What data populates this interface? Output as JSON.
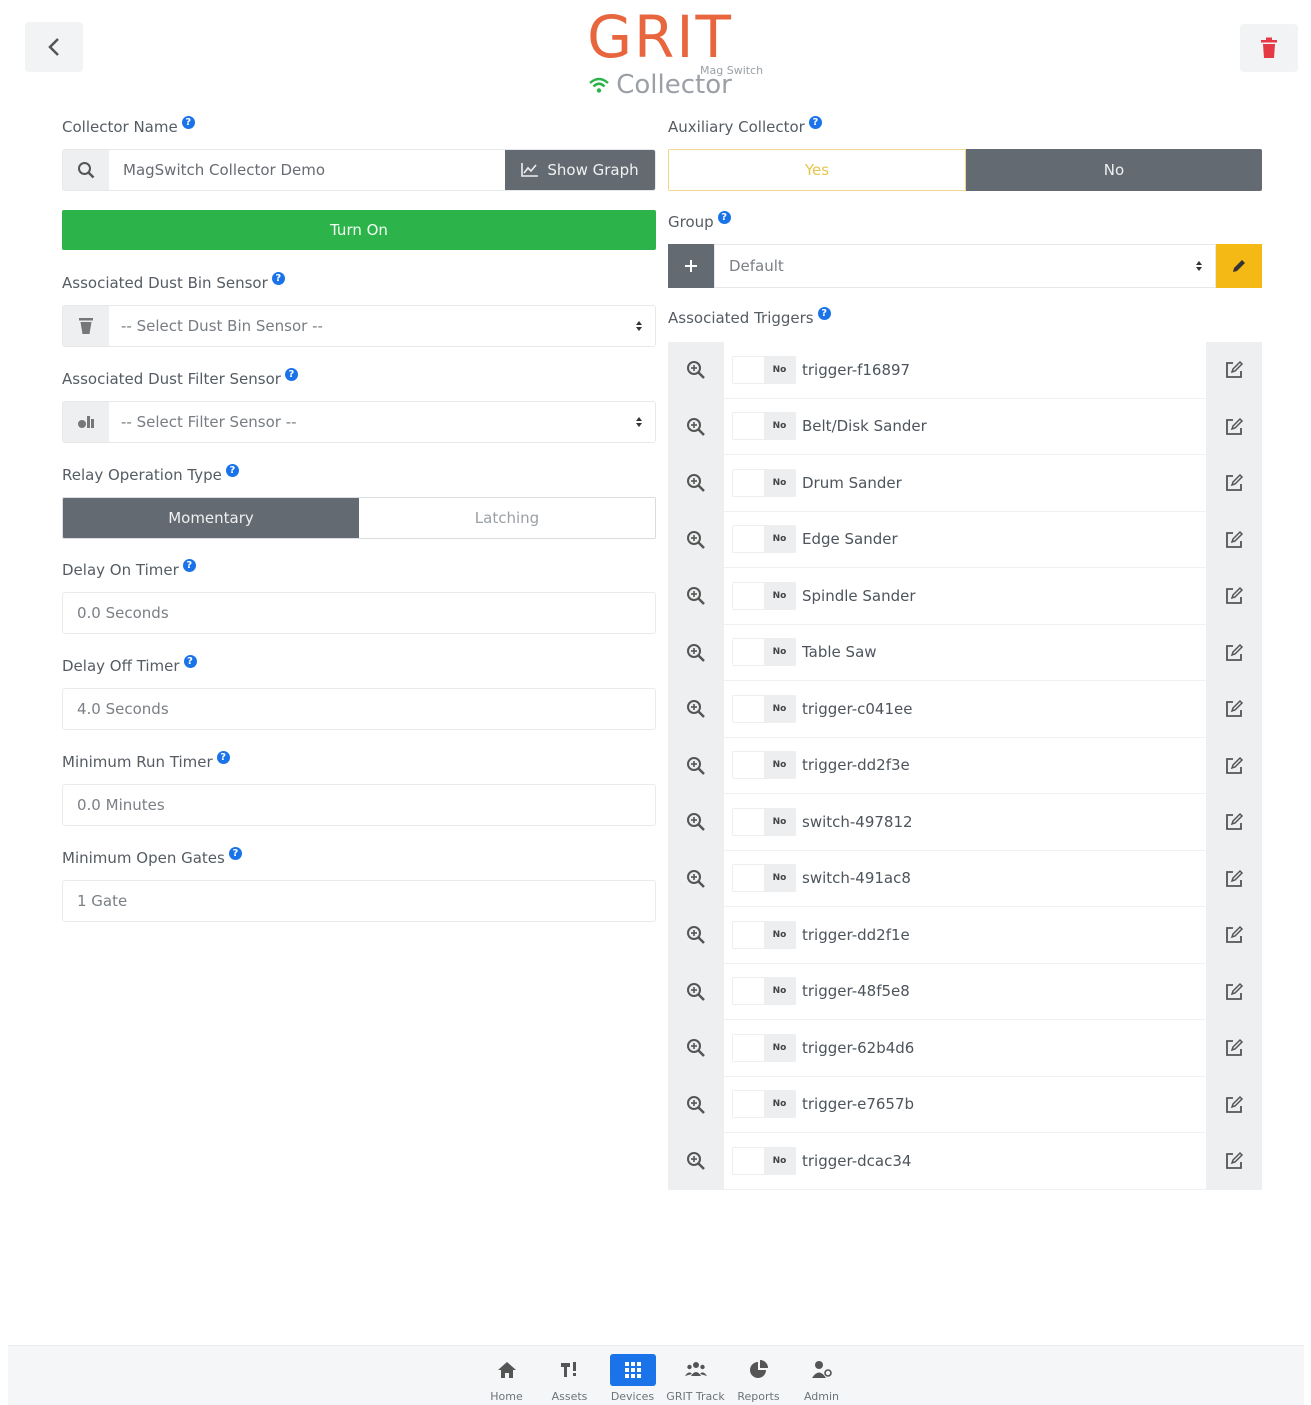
{
  "header": {
    "brand_title": "GRIT",
    "brand_subtitle": "Collector",
    "brand_tag": "Mag Switch"
  },
  "collector_name": {
    "label": "Collector Name",
    "value": "MagSwitch Collector Demo",
    "show_graph_label": "Show Graph"
  },
  "turn_on_label": "Turn On",
  "dust_bin": {
    "label": "Associated Dust Bin Sensor",
    "placeholder": "-- Select Dust Bin Sensor --"
  },
  "dust_filter": {
    "label": "Associated Dust Filter Sensor",
    "placeholder": "-- Select Filter Sensor --"
  },
  "relay": {
    "label": "Relay Operation Type",
    "options": [
      "Momentary",
      "Latching"
    ],
    "selected": "Momentary"
  },
  "delay_on": {
    "label": "Delay On Timer",
    "value": "0.0 Seconds"
  },
  "delay_off": {
    "label": "Delay Off Timer",
    "value": "4.0 Seconds"
  },
  "min_run": {
    "label": "Minimum Run Timer",
    "value": "0.0 Minutes"
  },
  "min_gates": {
    "label": "Minimum Open Gates",
    "value": "1 Gate"
  },
  "auxiliary": {
    "label": "Auxiliary Collector",
    "yes_label": "Yes",
    "no_label": "No",
    "selected": "No"
  },
  "group": {
    "label": "Group",
    "value": "Default"
  },
  "triggers": {
    "label": "Associated Triggers",
    "toggle_label": "No",
    "items": [
      "trigger-f16897",
      "Belt/Disk Sander",
      "Drum Sander",
      "Edge Sander",
      "Spindle Sander",
      "Table Saw",
      "trigger-c041ee",
      "trigger-dd2f3e",
      "switch-497812",
      "switch-491ac8",
      "trigger-dd2f1e",
      "trigger-48f5e8",
      "trigger-62b4d6",
      "trigger-e7657b",
      "trigger-dcac34"
    ]
  },
  "nav": {
    "items": [
      {
        "label": "Home",
        "icon": "home-icon"
      },
      {
        "label": "Assets",
        "icon": "assets-icon"
      },
      {
        "label": "Devices",
        "icon": "devices-icon"
      },
      {
        "label": "GRIT Track",
        "icon": "users-icon"
      },
      {
        "label": "Reports",
        "icon": "pie-chart-icon"
      },
      {
        "label": "Admin",
        "icon": "admin-icon"
      }
    ],
    "active": "Devices"
  },
  "colors": {
    "brand": "#e8663d",
    "green": "#2cb34a",
    "dark_segment": "#636a71",
    "edit_yellow": "#f5b915",
    "help_blue": "#1a73e8",
    "delete_red": "#e53945"
  }
}
